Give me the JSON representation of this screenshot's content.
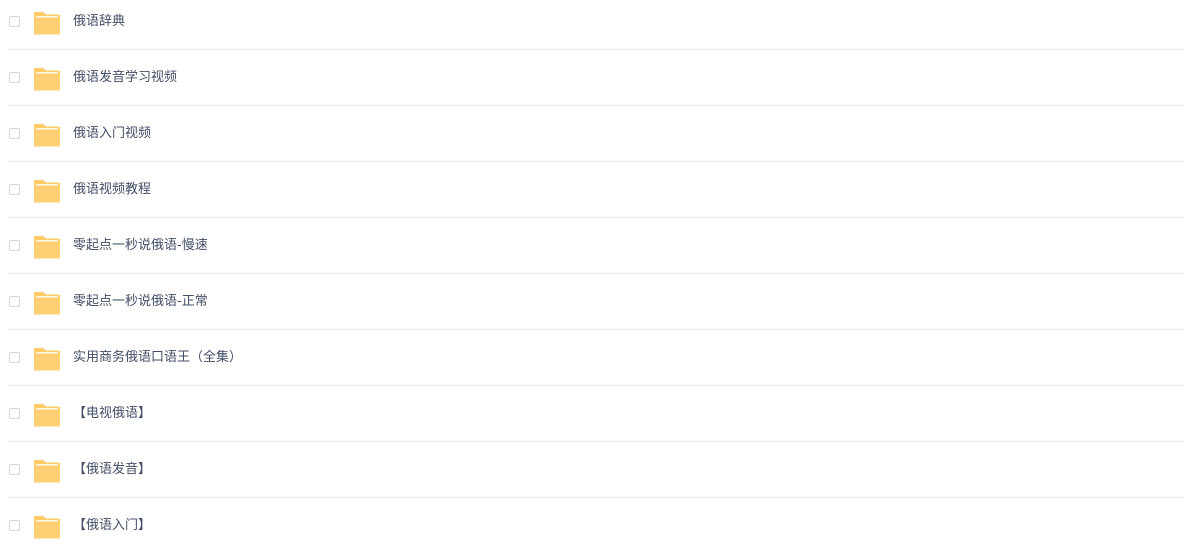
{
  "colors": {
    "folder_body": "#ffc967",
    "folder_tab": "#ffd98a",
    "folder_paper": "#ffffff",
    "text": "#424e67",
    "divider": "#e8ebf0"
  },
  "files": [
    {
      "name": "俄语辞典",
      "icon": "folder-icon"
    },
    {
      "name": "俄语发音学习视频",
      "icon": "folder-icon"
    },
    {
      "name": "俄语入门视频",
      "icon": "folder-icon"
    },
    {
      "name": "俄语视频教程",
      "icon": "folder-icon"
    },
    {
      "name": "零起点一秒说俄语-慢速",
      "icon": "folder-icon"
    },
    {
      "name": "零起点一秒说俄语-正常",
      "icon": "folder-icon"
    },
    {
      "name": "实用商务俄语口语王（全集）",
      "icon": "folder-icon"
    },
    {
      "name": "【电视俄语】",
      "icon": "folder-icon"
    },
    {
      "name": "【俄语发音】",
      "icon": "folder-icon"
    },
    {
      "name": "【俄语入门】",
      "icon": "folder-icon"
    }
  ]
}
